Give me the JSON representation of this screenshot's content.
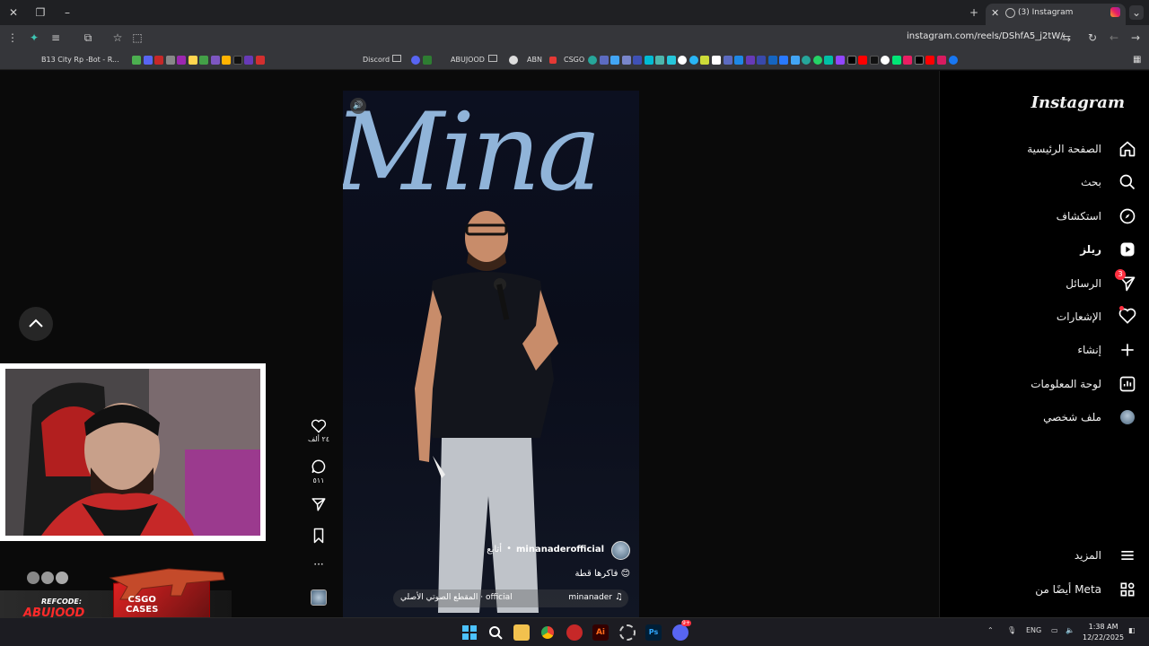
{
  "browser": {
    "tab_title": "(3) Instagram",
    "url": "instagram.com/reels/DShfA5_j2tW/",
    "bookmarks": [
      {
        "label": "B13 City Rp -Bot - R...",
        "color": "#6d6dff"
      },
      {
        "label": "Discord",
        "color": "#5865f2"
      },
      {
        "label": "ABUJOOD",
        "color": "#888888"
      },
      {
        "label": "ABN",
        "color": "#cccccc"
      },
      {
        "label": "CSGO",
        "color": "#e53935"
      }
    ]
  },
  "sidebar": {
    "logo": "Instagram",
    "items": [
      {
        "label": "الصفحة الرئيسية",
        "icon": "home-icon"
      },
      {
        "label": "بحث",
        "icon": "search-icon"
      },
      {
        "label": "استكشاف",
        "icon": "explore-icon"
      },
      {
        "label": "ريلز",
        "icon": "reels-icon"
      },
      {
        "label": "الرسائل",
        "icon": "messages-icon",
        "badge": "3"
      },
      {
        "label": "الإشعارات",
        "icon": "heart-icon"
      },
      {
        "label": "إنشاء",
        "icon": "plus-icon"
      },
      {
        "label": "لوحة المعلومات",
        "icon": "dashboard-icon"
      },
      {
        "label": "ملف شخصي",
        "icon": "avatar-icon"
      }
    ],
    "more": "المزيد",
    "meta": "أيضًا من Meta"
  },
  "reel": {
    "backdrop_text": "Mina",
    "username": "minanaderofficial",
    "follow": "أتابع",
    "caption": "فاكرها قطة 😊",
    "audio_artist": "minanader",
    "audio_title": "المقطع الصوتي الأصلي · official"
  },
  "actions": {
    "likes": "٢٤ ألف",
    "comments": "٥١١"
  },
  "promo": {
    "refcode_label": "REFCODE:",
    "refcode_value": "ABUJOOD",
    "cases_line1": "CSGO",
    "cases_line2": "CASES"
  },
  "taskbar": {
    "language": "ENG",
    "time": "1:38 AM",
    "date": "12/22/2025",
    "discord_badge": "9+"
  },
  "colors": {
    "accent": "#ff3040",
    "text": "#f0f0f0",
    "background": "#000000"
  }
}
